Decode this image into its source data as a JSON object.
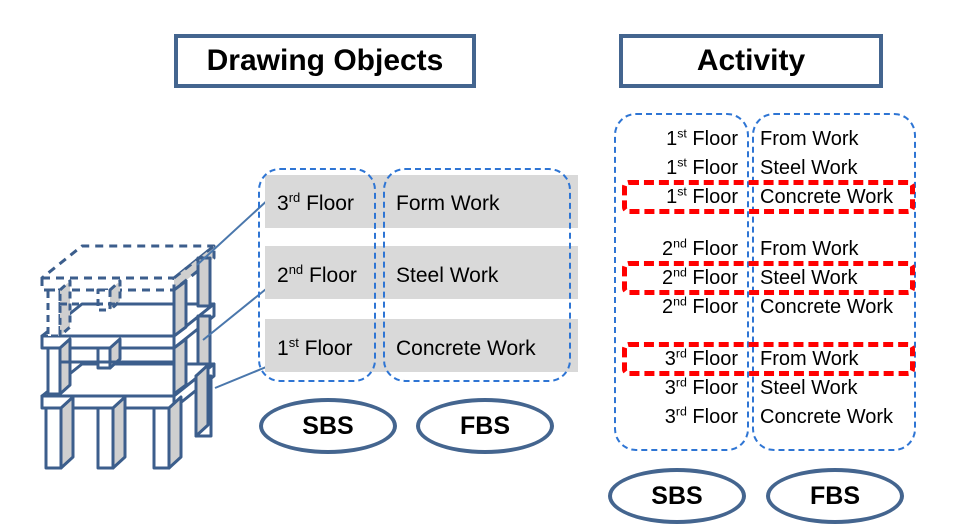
{
  "headers": {
    "drawing_objects": "Drawing Objects",
    "activity": "Activity"
  },
  "colors": {
    "frame_blue": "#44658f",
    "dashed_blue": "#2e75d4",
    "highlight_red": "#ff0000",
    "band_gray": "#d9d9d9",
    "building_fill": "#d0d0d0"
  },
  "drawing_objects": {
    "sbs_column": {
      "label": "SBS",
      "rows": [
        {
          "ordinal": "3",
          "suffix": "rd",
          "text": "Floor",
          "shaded": true
        },
        {
          "ordinal": "2",
          "suffix": "nd",
          "text": "Floor",
          "shaded": true
        },
        {
          "ordinal": "1",
          "suffix": "st",
          "text": "Floor",
          "shaded": true
        }
      ]
    },
    "fbs_column": {
      "label": "FBS",
      "rows": [
        {
          "text": "Form Work",
          "shaded": true
        },
        {
          "text": "Steel Work",
          "shaded": true
        },
        {
          "text": "Concrete Work",
          "shaded": true
        }
      ]
    }
  },
  "activity": {
    "sbs_label": "SBS",
    "fbs_label": "FBS",
    "groups": [
      {
        "rows": [
          {
            "ordinal": "1",
            "suffix": "st",
            "floor": "Floor",
            "work": "From Work",
            "highlighted": false
          },
          {
            "ordinal": "1",
            "suffix": "st",
            "floor": "Floor",
            "work": "Steel Work",
            "highlighted": false
          },
          {
            "ordinal": "1",
            "suffix": "st",
            "floor": "Floor",
            "work": "Concrete Work",
            "highlighted": true
          }
        ]
      },
      {
        "rows": [
          {
            "ordinal": "2",
            "suffix": "nd",
            "floor": "Floor",
            "work": "From Work",
            "highlighted": false
          },
          {
            "ordinal": "2",
            "suffix": "nd",
            "floor": "Floor",
            "work": "Steel Work",
            "highlighted": true
          },
          {
            "ordinal": "2",
            "suffix": "nd",
            "floor": "Floor",
            "work": "Concrete Work",
            "highlighted": false
          }
        ]
      },
      {
        "rows": [
          {
            "ordinal": "3",
            "suffix": "rd",
            "floor": "Floor",
            "work": "From Work",
            "highlighted": true
          },
          {
            "ordinal": "3",
            "suffix": "rd",
            "floor": "Floor",
            "work": "Steel Work",
            "highlighted": false
          },
          {
            "ordinal": "3",
            "suffix": "rd",
            "floor": "Floor",
            "work": "Concrete Work",
            "highlighted": false
          }
        ]
      }
    ]
  },
  "building": {
    "name": "isometric-3-story-frame-diagram",
    "stories": 3,
    "connector_count": 3
  }
}
